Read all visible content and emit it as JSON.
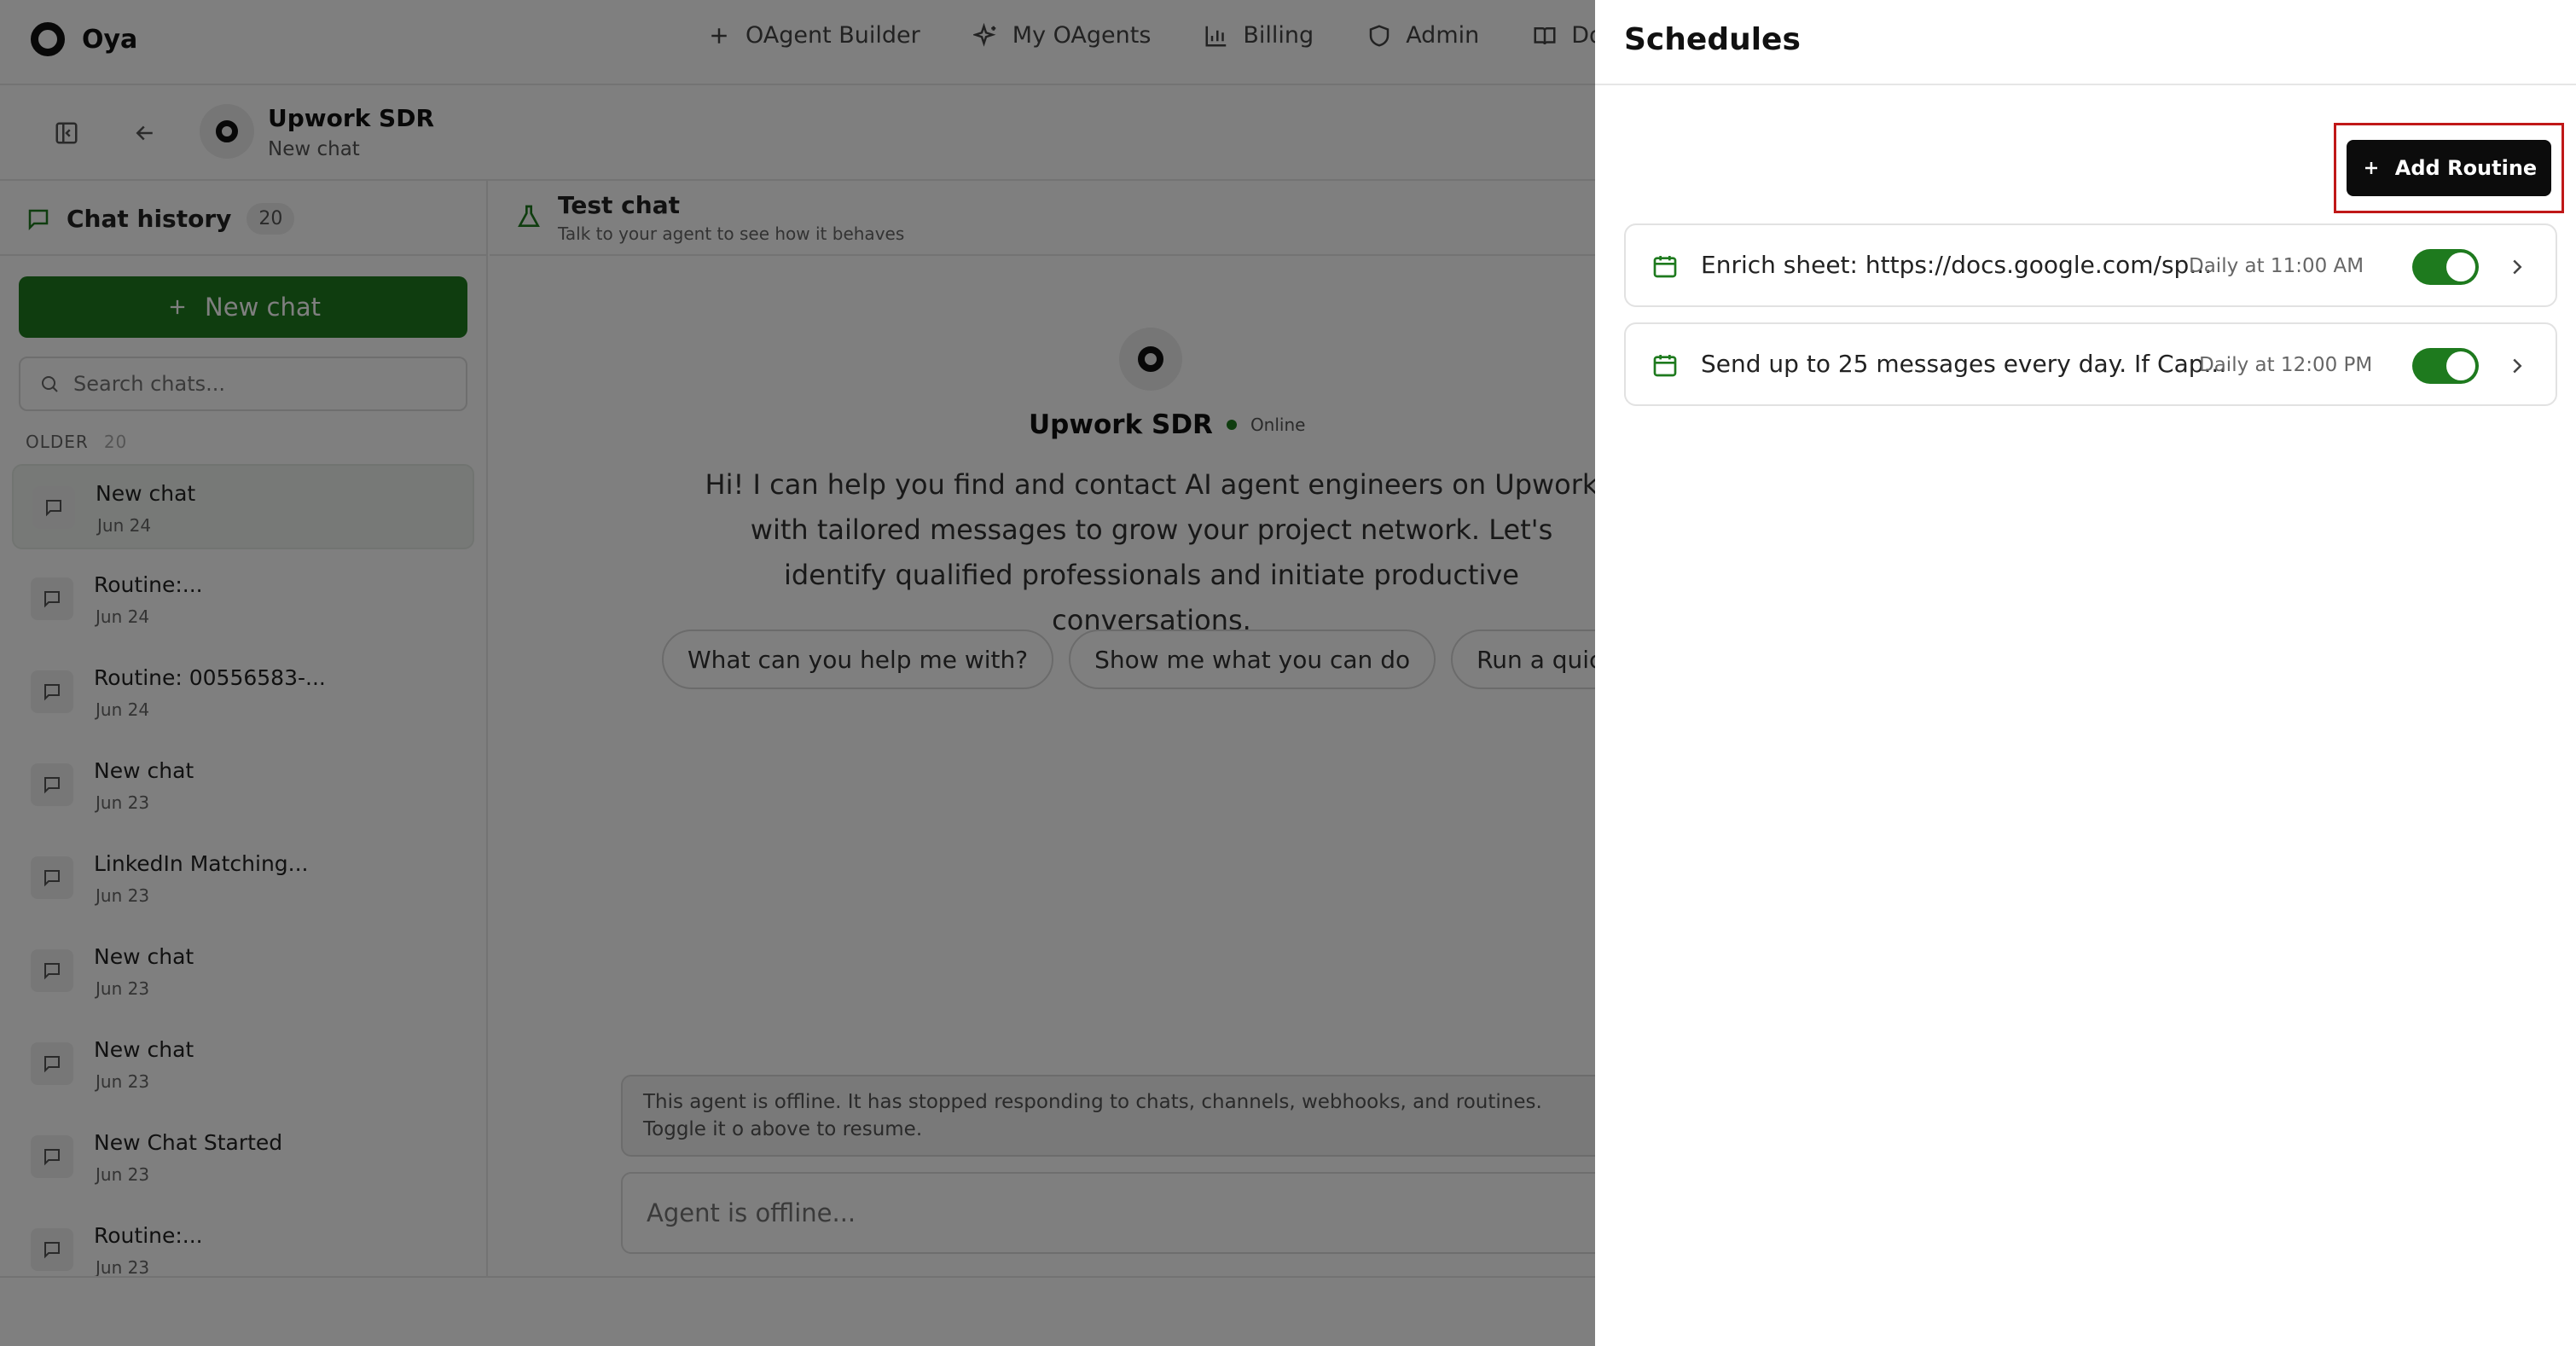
{
  "brand": {
    "name": "Oya"
  },
  "nav": [
    {
      "label": "OAgent Builder",
      "icon": "plus-icon"
    },
    {
      "label": "My OAgents",
      "icon": "sparkle-icon"
    },
    {
      "label": "Billing",
      "icon": "bar-chart-icon"
    },
    {
      "label": "Admin",
      "icon": "shield-icon"
    },
    {
      "label": "Docs",
      "icon": "book-icon"
    }
  ],
  "agent": {
    "name": "Upwork SDR",
    "subtitle": "New chat",
    "status": "Online"
  },
  "sidebar": {
    "title": "Chat history",
    "count": "20",
    "new_chat": "New chat",
    "search_placeholder": "Search chats...",
    "section_label": "OLDER",
    "section_count": "20",
    "chats": [
      {
        "title": "New chat",
        "date": "Jun 24"
      },
      {
        "title": "Routine:...",
        "date": "Jun 24"
      },
      {
        "title": "Routine: 00556583-...",
        "date": "Jun 24"
      },
      {
        "title": "New chat",
        "date": "Jun 23"
      },
      {
        "title": "LinkedIn Matching...",
        "date": "Jun 23"
      },
      {
        "title": "New chat",
        "date": "Jun 23"
      },
      {
        "title": "New chat",
        "date": "Jun 23"
      },
      {
        "title": "New Chat Started",
        "date": "Jun 23"
      },
      {
        "title": "Routine:...",
        "date": "Jun 23"
      }
    ]
  },
  "test_chat": {
    "title": "Test chat",
    "subtitle": "Talk to your agent to see how it behaves",
    "greeting": "Hi! I can help you find and contact AI agent engineers on Upwork with tailored messages to grow your project network. Let's identify qualified professionals and initiate productive conversations.",
    "chips": [
      "What can you help me with?",
      "Show me what you can do",
      "Run a quick che"
    ],
    "offline_note": "This agent is offline. It has stopped responding to chats, channels, webhooks, and routines. Toggle it o above to resume.",
    "input_placeholder": "Agent is offline..."
  },
  "schedules": {
    "title": "Schedules",
    "add_button": "Add Routine",
    "routines": [
      {
        "title": "Enrich sheet: https://docs.google.com/sp...",
        "time": "Daily at 11:00 AM",
        "enabled": true
      },
      {
        "title": "Send up to 25 messages every day. If Cap...",
        "time": "Daily at 12:00 PM",
        "enabled": true
      }
    ]
  },
  "colors": {
    "accent": "#1e7a1e",
    "highlight": "#c01818",
    "primary_button": "#0c0c0c"
  }
}
